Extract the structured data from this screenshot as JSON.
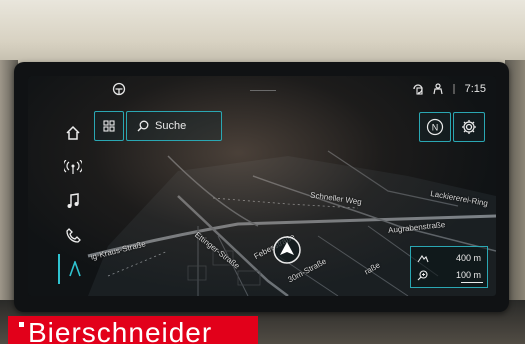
{
  "status": {
    "time": "7:15",
    "icons": [
      "car-icon",
      "phone-projection-icon",
      "person-icon",
      "signal-icon"
    ]
  },
  "sidebar": {
    "items": [
      {
        "name": "home",
        "icon": "home-icon"
      },
      {
        "name": "radio",
        "icon": "radio-icon"
      },
      {
        "name": "media",
        "icon": "music-note-icon"
      },
      {
        "name": "phone",
        "icon": "phone-icon"
      },
      {
        "name": "navigation",
        "icon": "navigation-icon",
        "active": true
      }
    ]
  },
  "toolbar": {
    "search_label": "Suche",
    "grid_icon": "grid-icon",
    "north_label": "N",
    "settings_icon": "gear-icon"
  },
  "map": {
    "streets": {
      "schneller_weg": "Schneller Weg",
      "lackiererei_ring": "Lackiererei-Ring",
      "augrabenstrasse": "Augrabenstraße",
      "kraus_strasse": "ig-Kraus-Straße",
      "ettinger_strasse": "Ettinger-Straße",
      "febesstrasse": "Febesstraße",
      "strasse_30m": "30m-Straße",
      "strasse_partial": "raße"
    },
    "scale": {
      "altitude": "400 m",
      "zoom": "100 m"
    }
  },
  "banner": {
    "text": "Bierschneider",
    "color": "#e2001a"
  },
  "colors": {
    "accent": "#2aa7b3",
    "screen_bg": "#0b0d0f"
  }
}
